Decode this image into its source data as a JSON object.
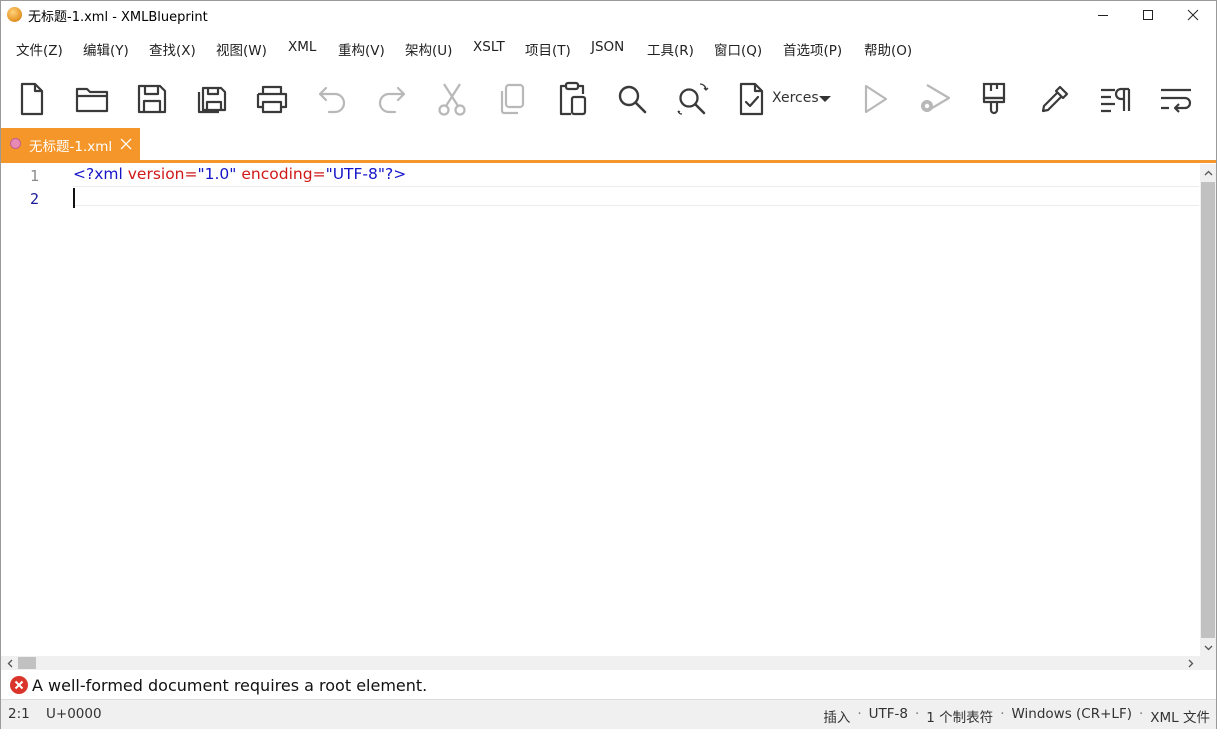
{
  "window": {
    "title": "无标题-1.xml - XMLBlueprint"
  },
  "menu": {
    "items": [
      {
        "label": "文件(Z)"
      },
      {
        "label": "编辑(Y)"
      },
      {
        "label": "查找(X)"
      },
      {
        "label": "视图(W)"
      },
      {
        "label": "XML"
      },
      {
        "label": "重构(V)"
      },
      {
        "label": "架构(U)"
      },
      {
        "label": "XSLT"
      },
      {
        "label": "项目(T)"
      },
      {
        "label": "JSON"
      },
      {
        "label": "工具(R)"
      },
      {
        "label": "窗口(Q)"
      },
      {
        "label": "首选项(P)"
      },
      {
        "label": "帮助(O)"
      }
    ]
  },
  "toolbar": {
    "validator_label": "Xerces",
    "icons": [
      "new-file-icon",
      "open-folder-icon",
      "save-icon",
      "save-all-icon",
      "print-icon",
      "undo-icon",
      "redo-icon",
      "cut-icon",
      "copy-icon",
      "paste-icon",
      "find-icon",
      "find-replace-icon",
      "validate-icon",
      "run-icon",
      "run-debug-icon",
      "pretty-print-icon",
      "eyedropper-icon",
      "show-formatting-icon",
      "word-wrap-icon"
    ]
  },
  "tabs": [
    {
      "label": "无标题-1.xml",
      "active": true
    }
  ],
  "editor": {
    "line_numbers": [
      "1",
      "2"
    ],
    "line1": {
      "open": "<?xml ",
      "attr1": "version",
      "eq1": "=",
      "val1": "\"1.0\"",
      "attr2": "encoding",
      "eq2": "=",
      "val2": "\"UTF-8\"",
      "close": "?>"
    }
  },
  "message": {
    "text": "A well-formed document requires a root element.",
    "level": "error"
  },
  "status": {
    "position": "2:1",
    "codepoint": "U+0000",
    "mode": "插入",
    "encoding": "UTF-8",
    "indent": "1 个制表符",
    "line_endings": "Windows (CR+LF)",
    "file_type": "XML 文件"
  },
  "colors": {
    "accent": "#f4962a",
    "error": "#d9352a",
    "xml_punct": "#1515c8",
    "xml_attr": "#d01818"
  }
}
